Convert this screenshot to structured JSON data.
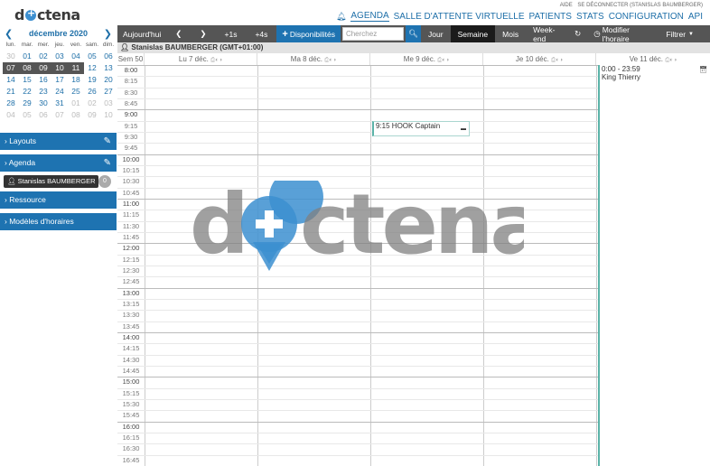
{
  "header": {
    "logo": "doctena",
    "toplinks": [
      "AIDE",
      "SE DÉCONNECTER (STANISLAS BAUMBERGER)"
    ],
    "nav": [
      "AGENDA",
      "SALLE D'ATTENTE VIRTUELLE",
      "PATIENTS",
      "STATS",
      "CONFIGURATION",
      "API"
    ],
    "active_nav": "AGENDA"
  },
  "minical": {
    "title": "décembre 2020",
    "day_names": [
      "lun.",
      "mar.",
      "mer.",
      "jeu.",
      "ven.",
      "sam.",
      "dim."
    ],
    "weeks": [
      [
        "30",
        "01",
        "02",
        "03",
        "04",
        "05",
        "06"
      ],
      [
        "07",
        "08",
        "09",
        "10",
        "11",
        "12",
        "13"
      ],
      [
        "14",
        "15",
        "16",
        "17",
        "18",
        "19",
        "20"
      ],
      [
        "21",
        "22",
        "23",
        "24",
        "25",
        "26",
        "27"
      ],
      [
        "28",
        "29",
        "30",
        "31",
        "01",
        "02",
        "03"
      ],
      [
        "04",
        "05",
        "06",
        "07",
        "08",
        "09",
        "10"
      ]
    ]
  },
  "sidebar": {
    "layouts": "Layouts",
    "agenda": "Agenda",
    "agenda_user": "Stanislas BAUMBERGER",
    "agenda_count": "0",
    "ressource": "Ressource",
    "modeles": "Modèles d'horaires"
  },
  "toolbar": {
    "today": "Aujourd'hui",
    "plus1": "+1s",
    "plus4": "+4s",
    "dispo": "Disponibilités",
    "search_placeholder": "Cherchez",
    "jour": "Jour",
    "semaine": "Semaine",
    "mois": "Mois",
    "weekend": "Week-end",
    "modifier": "Modifier l'horaire",
    "filtrer": "Filtrer"
  },
  "resource_header": "Stanislas BAUMBERGER (GMT+01:00)",
  "week_label": "Sem 50",
  "days": [
    "Lu 7 déc.",
    "Ma 8 déc.",
    "Me 9 déc.",
    "Je 10 déc.",
    "Ve 11 déc."
  ],
  "times": [
    "8:00",
    "8:15",
    "8:30",
    "8:45",
    "9:00",
    "9:15",
    "9:30",
    "9:45",
    "10:00",
    "10:15",
    "10:30",
    "10:45",
    "11:00",
    "11:15",
    "11:30",
    "11:45",
    "12:00",
    "12:15",
    "12:30",
    "12:45",
    "13:00",
    "13:15",
    "13:30",
    "13:45",
    "14:00",
    "14:15",
    "14:30",
    "14:45",
    "15:00",
    "15:15",
    "15:30",
    "15:45",
    "16:00",
    "16:15",
    "16:30",
    "16:45"
  ],
  "event": {
    "label": "9:15 HOOK Captain"
  },
  "allday_event": {
    "time": "0:00 - 23:59",
    "name": "King Thierry"
  },
  "watermark": "doctena",
  "colors": {
    "brand_blue": "#1e73b1",
    "toolbar": "#555555",
    "event_border": "#5bb3a8",
    "watermark_pin": "#3c8fd0"
  }
}
